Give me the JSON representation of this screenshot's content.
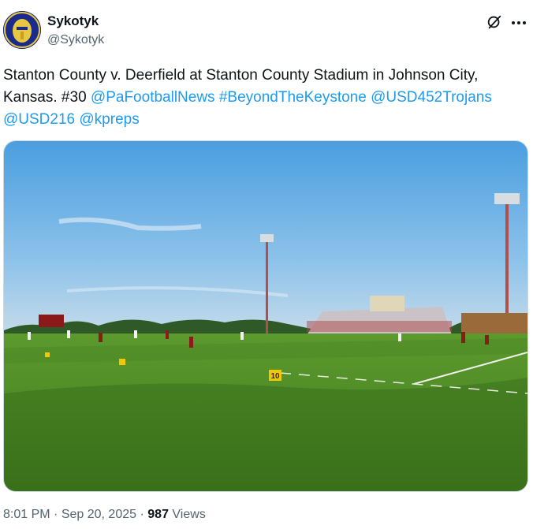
{
  "author": {
    "display_name": "Sykotyk",
    "handle": "@Sykotyk"
  },
  "tweet": {
    "text_part1": "Stanton County v. Deerfield at Stanton County Stadium in Johnson City, Kansas. #30 ",
    "links": [
      "@PaFootballNews",
      "#BeyondTheKeystone",
      "@USD452Trojans",
      "@USD216",
      "@kpreps"
    ]
  },
  "media": {
    "yard_marker": "10"
  },
  "meta": {
    "time": "8:01 PM",
    "separator": "·",
    "date": "Sep 20, 2025",
    "views_count": "987",
    "views_label": "Views"
  },
  "icons": {
    "grok": "grok-icon",
    "more": "more-icon"
  },
  "colors": {
    "link": "#1d9bf0",
    "text": "#0f1419",
    "muted": "#536471"
  }
}
